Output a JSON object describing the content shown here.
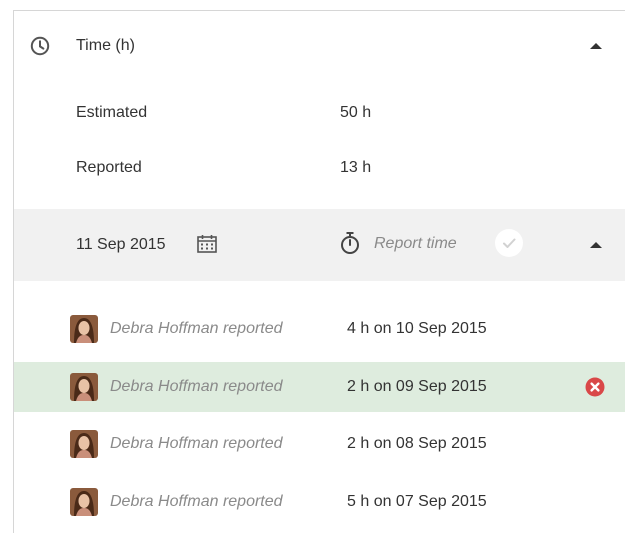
{
  "section": {
    "title": "Time (h)",
    "icon": "clock-icon"
  },
  "estimated": {
    "label": "Estimated",
    "value": "50 h"
  },
  "reported": {
    "label": "Reported",
    "value": "13 h"
  },
  "report_form": {
    "date": "11 Sep 2015",
    "placeholder": "Report time"
  },
  "entries": [
    {
      "author": "Debra Hoffman reported",
      "time": "4 h on 10 Sep 2015"
    },
    {
      "author": "Debra Hoffman reported",
      "time": "2 h on 09 Sep 2015"
    },
    {
      "author": "Debra Hoffman reported",
      "time": "2 h on 08 Sep 2015"
    },
    {
      "author": "Debra Hoffman reported",
      "time": "5 h on 07 Sep 2015"
    }
  ],
  "colors": {
    "highlight": "#deecde",
    "delete": "#d94848",
    "bar": "#f1f1f1",
    "icon": "#555555"
  }
}
